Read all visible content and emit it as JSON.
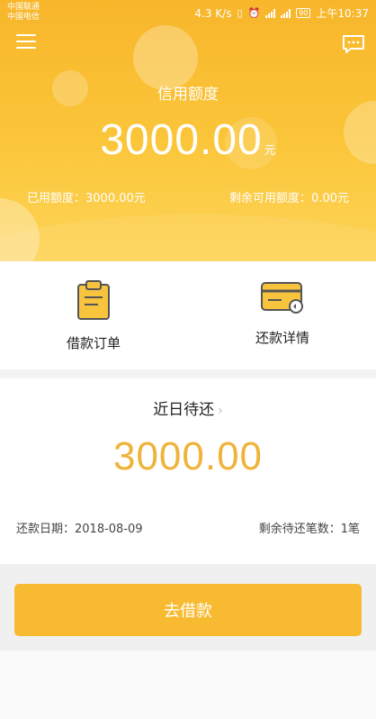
{
  "status_bar": {
    "carrier_1": "中国联通",
    "carrier_2": "中国电信",
    "net_speed": "4.3 K/s",
    "battery": "90",
    "time": "上午10:37"
  },
  "header": {
    "menu_icon": "menu-icon",
    "message_icon": "message-icon",
    "credit_title": "信用额度",
    "credit_amount": "3000.00",
    "credit_unit": "元",
    "used_label": "已用额度：3000.00元",
    "remaining_label": "剩余可用额度：0.00元"
  },
  "actions": [
    {
      "label": "借款订单",
      "icon": "clipboard-icon"
    },
    {
      "label": "还款详情",
      "icon": "card-icon"
    }
  ],
  "repay": {
    "title": "近日待还",
    "chevron": "›",
    "amount": "3000.00",
    "date_label": "还款日期：2018-08-09",
    "count_label": "剩余待还笔数：1笔"
  },
  "borrow_button": {
    "label": "去借款"
  },
  "colors": {
    "brand_yellow": "#f8b62b",
    "amount_yellow": "#f0b33a",
    "button_yellow": "#f8ba31"
  }
}
